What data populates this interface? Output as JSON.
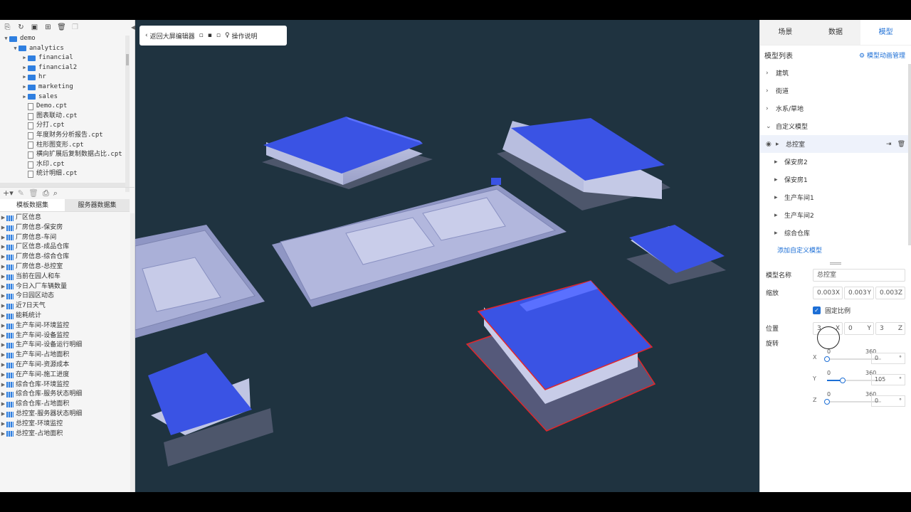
{
  "left_panel": {
    "tree": [
      {
        "label": "demo",
        "type": "folder",
        "level": 0,
        "expanded": true
      },
      {
        "label": "analytics",
        "type": "folder",
        "level": 1,
        "expanded": true
      },
      {
        "label": "financial",
        "type": "folder",
        "level": 2,
        "expanded": false
      },
      {
        "label": "financial2",
        "type": "folder",
        "level": 2,
        "expanded": false
      },
      {
        "label": "hr",
        "type": "folder",
        "level": 2,
        "expanded": false
      },
      {
        "label": "marketing",
        "type": "folder",
        "level": 2,
        "expanded": false
      },
      {
        "label": "sales",
        "type": "folder",
        "level": 2,
        "expanded": false
      },
      {
        "label": "Demo.cpt",
        "type": "file",
        "level": 2
      },
      {
        "label": "图表联动.cpt",
        "type": "file",
        "level": 2
      },
      {
        "label": "分打.cpt",
        "type": "file",
        "level": 2
      },
      {
        "label": "年度财务分析报告.cpt",
        "type": "file",
        "level": 2
      },
      {
        "label": "柱形图变形.cpt",
        "type": "file",
        "level": 2
      },
      {
        "label": "横向扩展后复制数据占比.cpt",
        "type": "file",
        "level": 2
      },
      {
        "label": "水印.cpt",
        "type": "file",
        "level": 2
      },
      {
        "label": "统计明细.cpt",
        "type": "file",
        "level": 2
      }
    ],
    "dataset_tabs": [
      "模板数据集",
      "服务器数据集"
    ],
    "datasets": [
      "厂区信息",
      "厂房信息-保安房",
      "厂房信息-车间",
      "厂区信息-成品仓库",
      "厂房信息-综合仓库",
      "厂房信息-总控室",
      "当前在园人和车",
      "今日入厂车辆数量",
      "今日园区动态",
      "近7日天气",
      "能耗统计",
      "生产车间-环境监控",
      "生产车间-设备监控",
      "生产车间-设备运行明细",
      "生产车间-占地面积",
      "在产车间-资源成本",
      "在产车间-施工进度",
      "综合仓库-环境监控",
      "综合仓库-服务状态明细",
      "综合仓库-占地面积",
      "总控室-服务器状态明细",
      "总控室-环境监控",
      "总控室-占地面积"
    ]
  },
  "viewport": {
    "toolbar": {
      "back_label": "返回大屏编辑器",
      "help_label": "操作说明"
    }
  },
  "right_panel": {
    "tabs": [
      {
        "label": "场景"
      },
      {
        "label": "数据"
      },
      {
        "label": "模型"
      }
    ],
    "active_tab": "模型",
    "list_title": "模型列表",
    "anim_link": "模型动画管理",
    "groups": [
      {
        "label": "建筑",
        "expanded": false
      },
      {
        "label": "街道",
        "expanded": false
      },
      {
        "label": "水系/草地",
        "expanded": false
      },
      {
        "label": "自定义模型",
        "expanded": true
      }
    ],
    "selected_model": "总控室",
    "sub_models": [
      "保安房2",
      "保安房1",
      "生产车间1",
      "生产车间2",
      "综合仓库"
    ],
    "add_link": "添加自定义模型",
    "props": {
      "name_label": "模型名称",
      "name_value": "总控室",
      "scale_label": "缩放",
      "scale": [
        {
          "v": "0.003",
          "a": "X"
        },
        {
          "v": "0.003",
          "a": "Y"
        },
        {
          "v": "0.003",
          "a": "Z"
        }
      ],
      "lock_label": "固定比例",
      "pos_label": "位置",
      "pos": [
        {
          "v": "3",
          "a": "X"
        },
        {
          "v": "0",
          "a": "Y"
        },
        {
          "v": "3",
          "a": "Z"
        }
      ],
      "rot_label": "旋转",
      "rot": [
        {
          "axis": "X",
          "min": "0",
          "max": "360",
          "value": 0,
          "display": "0"
        },
        {
          "axis": "Y",
          "min": "0",
          "max": "360",
          "value": 105,
          "display": "105"
        },
        {
          "axis": "Z",
          "min": "0",
          "max": "360",
          "value": 0,
          "display": "0"
        }
      ],
      "deg": "°"
    }
  }
}
